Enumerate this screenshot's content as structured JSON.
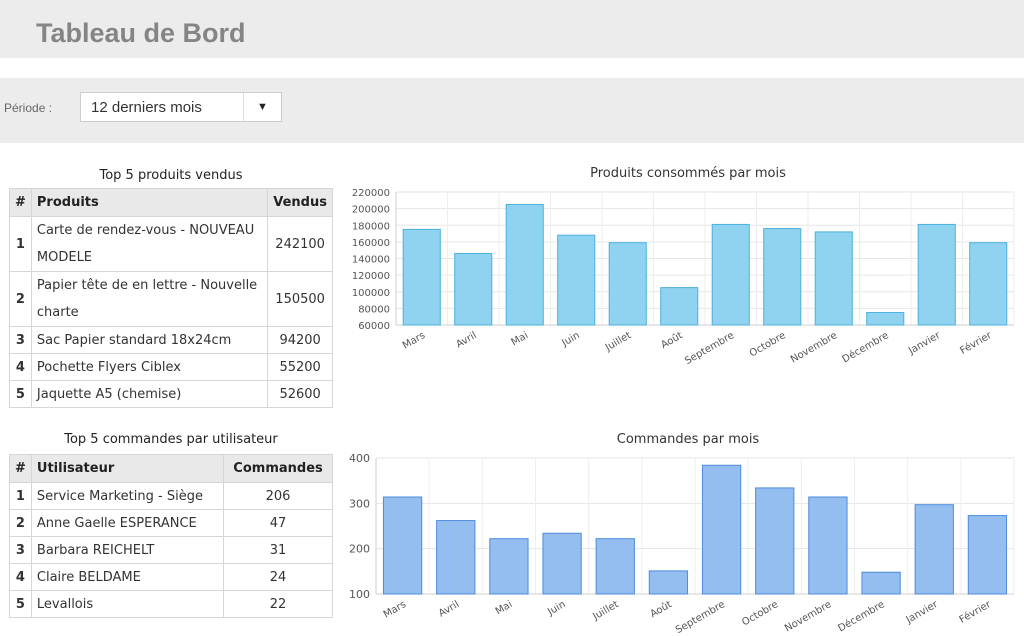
{
  "header": {
    "title": "Tableau de Bord"
  },
  "filter": {
    "label": "Période :",
    "selected": "12 derniers mois",
    "arrow": "▼"
  },
  "top_products": {
    "caption": "Top 5 produits vendus",
    "headers": [
      "#",
      "Produits",
      "Vendus"
    ],
    "rows": [
      {
        "rank": "1",
        "name": "Carte de rendez-vous - NOUVEAU MODELE",
        "value": "242100"
      },
      {
        "rank": "2",
        "name": "Papier tête de en lettre - Nouvelle charte",
        "value": "150500"
      },
      {
        "rank": "3",
        "name": "Sac Papier standard 18x24cm",
        "value": "94200"
      },
      {
        "rank": "4",
        "name": "Pochette Flyers Ciblex",
        "value": "55200"
      },
      {
        "rank": "5",
        "name": "Jaquette A5 (chemise)",
        "value": "52600"
      }
    ]
  },
  "top_orders": {
    "caption": "Top 5 commandes par utilisateur",
    "headers": [
      "#",
      "Utilisateur",
      "Commandes"
    ],
    "rows": [
      {
        "rank": "1",
        "name": "Service Marketing - Siège",
        "value": "206"
      },
      {
        "rank": "2",
        "name": "Anne Gaelle ESPERANCE",
        "value": "47"
      },
      {
        "rank": "3",
        "name": "Barbara REICHELT",
        "value": "31"
      },
      {
        "rank": "4",
        "name": "Claire BELDAME",
        "value": "24"
      },
      {
        "rank": "5",
        "name": "Levallois",
        "value": "22"
      }
    ]
  },
  "chart_data": [
    {
      "type": "bar",
      "title": "Produits consommés par mois",
      "categories": [
        "Mars",
        "Avril",
        "Mai",
        "Juin",
        "Juillet",
        "Août",
        "Septembre",
        "Octobre",
        "Novembre",
        "Décembre",
        "Janvier",
        "Février"
      ],
      "values": [
        175000,
        146000,
        205000,
        168000,
        159000,
        105000,
        181000,
        176000,
        172000,
        75000,
        181000,
        159000
      ],
      "ylim": [
        60000,
        220000
      ],
      "yticks": [
        60000,
        80000,
        100000,
        120000,
        140000,
        160000,
        180000,
        200000,
        220000
      ],
      "grid": true,
      "colors": {
        "fill": "#8fd3f0",
        "stroke": "#4cb1dc"
      }
    },
    {
      "type": "bar",
      "title": "Commandes par mois",
      "categories": [
        "Mars",
        "Avril",
        "Mai",
        "Juin",
        "Juillet",
        "Août",
        "Septembre",
        "Octobre",
        "Novembre",
        "Décembre",
        "Janvier",
        "Février"
      ],
      "values": [
        314,
        262,
        222,
        234,
        222,
        151,
        384,
        334,
        314,
        148,
        297,
        273
      ],
      "ylim": [
        100,
        400
      ],
      "yticks": [
        100,
        200,
        300,
        400
      ],
      "grid": true,
      "colors": {
        "fill": "#94bdf0",
        "stroke": "#4f8bdb"
      }
    }
  ]
}
